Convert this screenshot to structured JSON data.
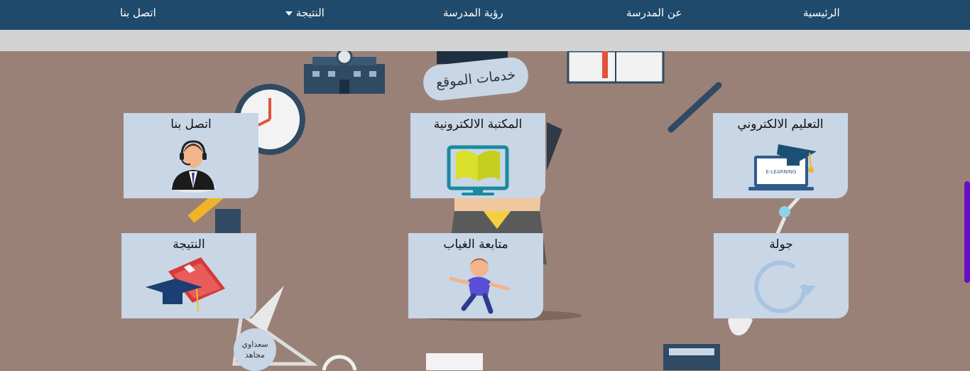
{
  "nav": {
    "home": "الرئيسية",
    "about": "عن المدرسة",
    "vision": "رؤية المدرسة",
    "result": "النتيجة",
    "contact": "اتصل بنا"
  },
  "services_label": "خدمات الموقع",
  "cards": {
    "elearning": "التعليم الالكتروني",
    "elearning_screen_text": "E-LEARNING",
    "library": "المكتبة الالكترونية",
    "contact": "اتصل بنا",
    "tour": "جولة",
    "attendance": "متابعة الغياب",
    "result": "النتيجة"
  },
  "badge": {
    "line1": "سعداوي",
    "line2": "مجاهد"
  },
  "colors": {
    "navbar": "#1f4a6b",
    "card": "#c8d6e6",
    "background": "#9a8177",
    "scrollbar": "#6a0dc7"
  }
}
